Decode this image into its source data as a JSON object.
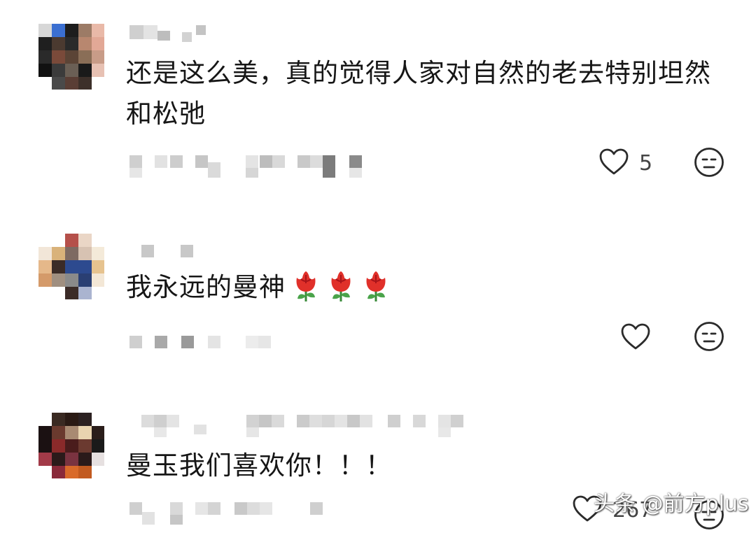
{
  "comments": [
    {
      "text": "还是这么美，真的觉得人家对自然的老去特别坦然和松弛",
      "likes": "5",
      "avatar_colors": [
        "#3b6fd1",
        "#e9b9a8",
        "#1d1d1d",
        "#8a6e57"
      ]
    },
    {
      "text": "我永远的曼神",
      "emoji_icons": [
        "rose-icon",
        "rose-icon",
        "rose-icon"
      ],
      "likes": "",
      "avatar_colors": [
        "#b5504a",
        "#2d4a8f",
        "#d9b27a",
        "#3b2b27"
      ]
    },
    {
      "text": "曼玉我们喜欢你！！！",
      "likes": "267",
      "avatar_colors": [
        "#1b1112",
        "#8a2a2a",
        "#d96a2a",
        "#e9d4b0"
      ]
    }
  ],
  "watermark": "头条 @前方plus",
  "colors": {
    "icon": "#2b2b2b",
    "mosaic": "#c9c9c9"
  }
}
